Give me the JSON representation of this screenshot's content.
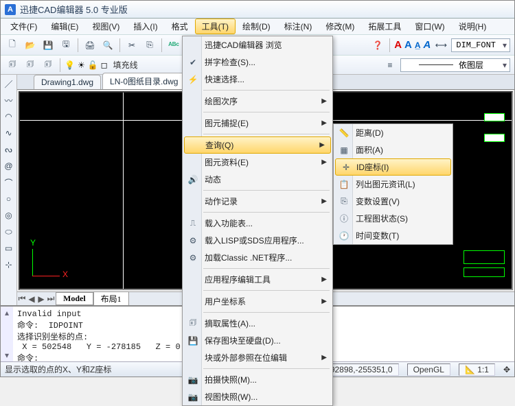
{
  "title": "迅捷CAD编辑器 5.0 专业版",
  "menubar": [
    "文件(F)",
    "编辑(E)",
    "视图(V)",
    "插入(I)",
    "格式",
    "工具(T)",
    "绘制(D)",
    "标注(N)",
    "修改(M)",
    "拓展工具",
    "窗口(W)",
    "说明(H)"
  ],
  "toolbar2": {
    "fill_label": "填充线",
    "dim_font": "DIM_FONT",
    "layer_dd": "依图层"
  },
  "doc_tabs": [
    "Drawing1.dwg",
    "LN-0图纸目录.dwg"
  ],
  "layout_tabs": [
    "Model",
    "布局1"
  ],
  "cmd_lines": "Invalid input\n命令:  IDPOINT\n选择识别坐标的点:\n X = 502548   Y = -278185   Z = 0\n命令:",
  "statusbar": {
    "hint": "显示选取的点的X、Y和Z座标",
    "coords": "492898,-255351,0",
    "renderer": "OpenGL",
    "scale": "1:1"
  },
  "tools_menu": [
    {
      "icon": "",
      "label": "迅捷CAD编辑器 浏览"
    },
    {
      "icon": "✔",
      "label": "拼字检查(S)..."
    },
    {
      "icon": "⚡",
      "label": "快速选择..."
    },
    {
      "sep": true
    },
    {
      "icon": "",
      "label": "绘图次序",
      "sub": true
    },
    {
      "sep": true
    },
    {
      "icon": "",
      "label": "图元捕捉(E)",
      "sub": true
    },
    {
      "sep": true
    },
    {
      "icon": "",
      "label": "查询(Q)",
      "sub": true,
      "hl": true
    },
    {
      "icon": "",
      "label": "图元资料(E)",
      "sub": true
    },
    {
      "icon": "🔊",
      "label": "动态"
    },
    {
      "sep": true
    },
    {
      "icon": "",
      "label": "动作记录",
      "sub": true
    },
    {
      "sep": true
    },
    {
      "icon": "⎍",
      "label": "载入功能表..."
    },
    {
      "icon": "⚙",
      "label": "载入LISP或SDS应用程序..."
    },
    {
      "icon": "⚙",
      "label": "加载Classic .NET程序..."
    },
    {
      "sep": true
    },
    {
      "icon": "",
      "label": "应用程序编辑工具",
      "sub": true
    },
    {
      "sep": true
    },
    {
      "icon": "",
      "label": "用户坐标系",
      "sub": true
    },
    {
      "sep": true
    },
    {
      "icon": "🗊",
      "label": "摘取属性(A)..."
    },
    {
      "icon": "💾",
      "label": "保存图块至硬盘(D)..."
    },
    {
      "icon": "",
      "label": "块或外部参照在位编辑",
      "sub": true
    },
    {
      "sep": true
    },
    {
      "icon": "📷",
      "label": "拍摄快照(M)..."
    },
    {
      "icon": "📷",
      "label": "视图快照(W)..."
    }
  ],
  "query_submenu": [
    {
      "icon": "📏",
      "label": "距离(D)"
    },
    {
      "icon": "▦",
      "label": "面积(A)"
    },
    {
      "icon": "✛",
      "label": "ID座标(I)",
      "hl": true
    },
    {
      "icon": "📋",
      "label": "列出图元资讯(L)"
    },
    {
      "icon": "⎘",
      "label": "变数设置(V)"
    },
    {
      "icon": "ⓘ",
      "label": "工程图状态(S)"
    },
    {
      "icon": "🕐",
      "label": "时间变数(T)"
    }
  ]
}
